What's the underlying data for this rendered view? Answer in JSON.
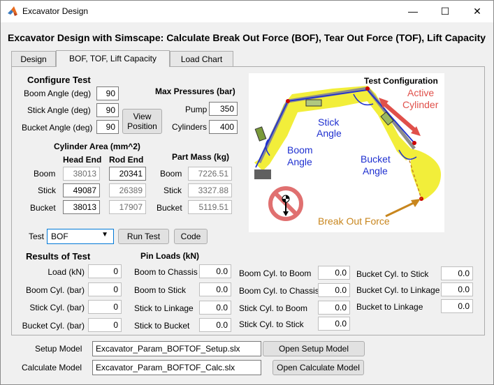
{
  "window": {
    "title": "Excavator Design",
    "minimize": "—",
    "maximize": "☐",
    "close": "✕"
  },
  "heading": "Excavator Design with Simscape: Calculate Break Out Force (BOF), Tear Out Force (TOF), Lift Capacity",
  "tabs": [
    "Design",
    "BOF, TOF, Lift Capacity",
    "Load Chart"
  ],
  "configure": {
    "title": "Configure Test",
    "boom_angle_label": "Boom Angle (deg)",
    "boom_angle": "90",
    "stick_angle_label": "Stick Angle (deg)",
    "stick_angle": "90",
    "bucket_angle_label": "Bucket Angle (deg)",
    "bucket_angle": "90",
    "view_position_line1": "View",
    "view_position_line2": "Position"
  },
  "pressures": {
    "title": "Max Pressures (bar)",
    "pump_label": "Pump",
    "pump": "350",
    "cylinders_label": "Cylinders",
    "cylinders": "400"
  },
  "cylinder_area": {
    "title": "Cylinder Area (mm^2)",
    "head_end": "Head End",
    "rod_end": "Rod End",
    "rows": [
      {
        "label": "Boom",
        "head": "38013",
        "rod": "20341"
      },
      {
        "label": "Stick",
        "head": "49087",
        "rod": "26389"
      },
      {
        "label": "Bucket",
        "head": "38013",
        "rod": "17907"
      }
    ]
  },
  "part_mass": {
    "title": "Part Mass (kg)",
    "rows": [
      {
        "label": "Boom",
        "value": "7226.51"
      },
      {
        "label": "Stick",
        "value": "3327.88"
      },
      {
        "label": "Bucket",
        "value": "5119.51"
      }
    ]
  },
  "test": {
    "label": "Test",
    "selected": "BOF",
    "run_test": "Run Test",
    "code": "Code"
  },
  "figure": {
    "title": "Test Configuration",
    "active_cylinder_1": "Active",
    "active_cylinder_2": "Cylinder",
    "stick_angle_1": "Stick",
    "stick_angle_2": "Angle",
    "boom_angle_1": "Boom",
    "boom_angle_2": "Angle",
    "bucket_angle_1": "Bucket",
    "bucket_angle_2": "Angle",
    "break_out_force": "Break Out Force"
  },
  "results": {
    "title": "Results of Test",
    "rows": [
      {
        "label": "Load (kN)",
        "value": "0"
      },
      {
        "label": "Boom Cyl. (bar)",
        "value": "0"
      },
      {
        "label": "Stick Cyl. (bar)",
        "value": "0"
      },
      {
        "label": "Bucket Cyl. (bar)",
        "value": "0"
      }
    ]
  },
  "pin_loads": {
    "title": "Pin Loads (kN)",
    "col1": [
      {
        "label": "Boom to Chassis",
        "value": "0.0"
      },
      {
        "label": "Boom to Stick",
        "value": "0.0"
      },
      {
        "label": "Stick to Linkage",
        "value": "0.0"
      },
      {
        "label": "Stick to Bucket",
        "value": "0.0"
      }
    ],
    "col2": [
      {
        "label": "Boom Cyl. to Boom",
        "value": "0.0"
      },
      {
        "label": "Boom Cyl. to Chassis",
        "value": "0.0"
      },
      {
        "label": "Stick Cyl. to Boom",
        "value": "0.0"
      },
      {
        "label": "Stick Cyl. to Stick",
        "value": "0.0"
      }
    ],
    "col3": [
      {
        "label": "Bucket Cyl. to Stick",
        "value": "0.0"
      },
      {
        "label": "Bucket Cyl. to Linkage",
        "value": "0.0"
      },
      {
        "label": "Bucket to Linkage",
        "value": "0.0"
      }
    ]
  },
  "models": {
    "setup_label": "Setup Model",
    "setup_value": "Excavator_Param_BOFTOF_Setup.slx",
    "open_setup": "Open Setup Model",
    "calc_label": "Calculate Model",
    "calc_value": "Excavator_Param_BOFTOF_Calc.slx",
    "open_calc": "Open Calculate Model"
  },
  "colors": {
    "accent_blue": "#0078d7",
    "boom_yellow": "#f2ee3a",
    "active_red": "#e0504a",
    "force_orange": "#c8861e",
    "angle_blue": "#1f30d0"
  }
}
